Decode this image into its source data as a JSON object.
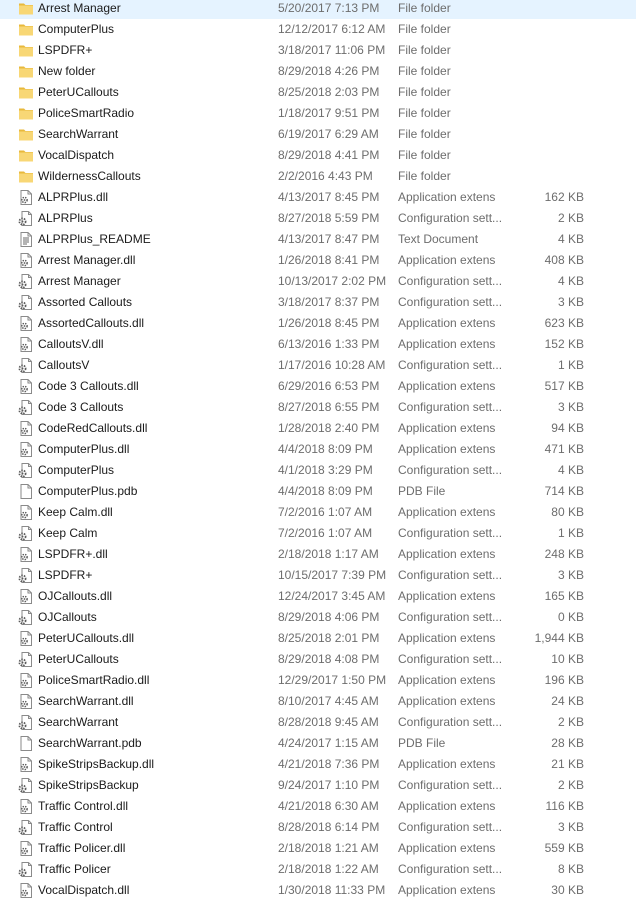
{
  "colors": {
    "folder": "#f8d775",
    "folder_shade": "#e8b93c",
    "text_primary": "#1a1a1a",
    "text_secondary": "#6d6d6d"
  },
  "files": [
    {
      "name": "Arrest Manager",
      "date": "5/20/2017 7:13 PM",
      "type": "File folder",
      "size": "",
      "icon": "folder-icon"
    },
    {
      "name": "ComputerPlus",
      "date": "12/12/2017 6:12 AM",
      "type": "File folder",
      "size": "",
      "icon": "folder-icon"
    },
    {
      "name": "LSPDFR+",
      "date": "3/18/2017 11:06 PM",
      "type": "File folder",
      "size": "",
      "icon": "folder-icon"
    },
    {
      "name": "New folder",
      "date": "8/29/2018 4:26 PM",
      "type": "File folder",
      "size": "",
      "icon": "folder-icon"
    },
    {
      "name": "PeterUCallouts",
      "date": "8/25/2018 2:03 PM",
      "type": "File folder",
      "size": "",
      "icon": "folder-icon"
    },
    {
      "name": "PoliceSmartRadio",
      "date": "1/18/2017 9:51 PM",
      "type": "File folder",
      "size": "",
      "icon": "folder-icon"
    },
    {
      "name": "SearchWarrant",
      "date": "6/19/2017 6:29 AM",
      "type": "File folder",
      "size": "",
      "icon": "folder-icon"
    },
    {
      "name": "VocalDispatch",
      "date": "8/29/2018 4:41 PM",
      "type": "File folder",
      "size": "",
      "icon": "folder-icon"
    },
    {
      "name": "WildernessCallouts",
      "date": "2/2/2016 4:43 PM",
      "type": "File folder",
      "size": "",
      "icon": "folder-icon"
    },
    {
      "name": "ALPRPlus.dll",
      "date": "4/13/2017 8:45 PM",
      "type": "Application extens",
      "size": "162 KB",
      "icon": "dll-file-icon"
    },
    {
      "name": "ALPRPlus",
      "date": "8/27/2018 5:59 PM",
      "type": "Configuration sett...",
      "size": "2 KB",
      "icon": "config-file-icon"
    },
    {
      "name": "ALPRPlus_README",
      "date": "4/13/2017 8:47 PM",
      "type": "Text Document",
      "size": "4 KB",
      "icon": "text-document-icon"
    },
    {
      "name": "Arrest Manager.dll",
      "date": "1/26/2018 8:41 PM",
      "type": "Application extens",
      "size": "408 KB",
      "icon": "dll-file-icon"
    },
    {
      "name": "Arrest Manager",
      "date": "10/13/2017 2:02 PM",
      "type": "Configuration sett...",
      "size": "4 KB",
      "icon": "config-file-icon"
    },
    {
      "name": "Assorted Callouts",
      "date": "3/18/2017 8:37 PM",
      "type": "Configuration sett...",
      "size": "3 KB",
      "icon": "config-file-icon"
    },
    {
      "name": "AssortedCallouts.dll",
      "date": "1/26/2018 8:45 PM",
      "type": "Application extens",
      "size": "623 KB",
      "icon": "dll-file-icon"
    },
    {
      "name": "CalloutsV.dll",
      "date": "6/13/2016 1:33 PM",
      "type": "Application extens",
      "size": "152 KB",
      "icon": "dll-file-icon"
    },
    {
      "name": "CalloutsV",
      "date": "1/17/2016 10:28 AM",
      "type": "Configuration sett...",
      "size": "1 KB",
      "icon": "config-file-icon"
    },
    {
      "name": "Code 3 Callouts.dll",
      "date": "6/29/2016 6:53 PM",
      "type": "Application extens",
      "size": "517 KB",
      "icon": "dll-file-icon"
    },
    {
      "name": "Code 3 Callouts",
      "date": "8/27/2018 6:55 PM",
      "type": "Configuration sett...",
      "size": "3 KB",
      "icon": "config-file-icon"
    },
    {
      "name": "CodeRedCallouts.dll",
      "date": "1/28/2018 2:40 PM",
      "type": "Application extens",
      "size": "94 KB",
      "icon": "dll-file-icon"
    },
    {
      "name": "ComputerPlus.dll",
      "date": "4/4/2018 8:09 PM",
      "type": "Application extens",
      "size": "471 KB",
      "icon": "dll-file-icon"
    },
    {
      "name": "ComputerPlus",
      "date": "4/1/2018 3:29 PM",
      "type": "Configuration sett...",
      "size": "4 KB",
      "icon": "config-file-icon"
    },
    {
      "name": "ComputerPlus.pdb",
      "date": "4/4/2018 8:09 PM",
      "type": "PDB File",
      "size": "714 KB",
      "icon": "blank-file-icon"
    },
    {
      "name": "Keep Calm.dll",
      "date": "7/2/2016 1:07 AM",
      "type": "Application extens",
      "size": "80 KB",
      "icon": "dll-file-icon"
    },
    {
      "name": "Keep Calm",
      "date": "7/2/2016 1:07 AM",
      "type": "Configuration sett...",
      "size": "1 KB",
      "icon": "config-file-icon"
    },
    {
      "name": "LSPDFR+.dll",
      "date": "2/18/2018 1:17 AM",
      "type": "Application extens",
      "size": "248 KB",
      "icon": "dll-file-icon"
    },
    {
      "name": "LSPDFR+",
      "date": "10/15/2017 7:39 PM",
      "type": "Configuration sett...",
      "size": "3 KB",
      "icon": "config-file-icon"
    },
    {
      "name": "OJCallouts.dll",
      "date": "12/24/2017 3:45 AM",
      "type": "Application extens",
      "size": "165 KB",
      "icon": "dll-file-icon"
    },
    {
      "name": "OJCallouts",
      "date": "8/29/2018 4:06 PM",
      "type": "Configuration sett...",
      "size": "0 KB",
      "icon": "config-file-icon"
    },
    {
      "name": "PeterUCallouts.dll",
      "date": "8/25/2018 2:01 PM",
      "type": "Application extens",
      "size": "1,944 KB",
      "icon": "dll-file-icon"
    },
    {
      "name": "PeterUCallouts",
      "date": "8/29/2018 4:08 PM",
      "type": "Configuration sett...",
      "size": "10 KB",
      "icon": "config-file-icon"
    },
    {
      "name": "PoliceSmartRadio.dll",
      "date": "12/29/2017 1:50 PM",
      "type": "Application extens",
      "size": "196 KB",
      "icon": "dll-file-icon"
    },
    {
      "name": "SearchWarrant.dll",
      "date": "8/10/2017 4:45 AM",
      "type": "Application extens",
      "size": "24 KB",
      "icon": "dll-file-icon"
    },
    {
      "name": "SearchWarrant",
      "date": "8/28/2018 9:45 AM",
      "type": "Configuration sett...",
      "size": "2 KB",
      "icon": "config-file-icon"
    },
    {
      "name": "SearchWarrant.pdb",
      "date": "4/24/2017 1:15 AM",
      "type": "PDB File",
      "size": "28 KB",
      "icon": "blank-file-icon"
    },
    {
      "name": "SpikeStripsBackup.dll",
      "date": "4/21/2018 7:36 PM",
      "type": "Application extens",
      "size": "21 KB",
      "icon": "dll-file-icon"
    },
    {
      "name": "SpikeStripsBackup",
      "date": "9/24/2017 1:10 PM",
      "type": "Configuration sett...",
      "size": "2 KB",
      "icon": "config-file-icon"
    },
    {
      "name": "Traffic Control.dll",
      "date": "4/21/2018 6:30 AM",
      "type": "Application extens",
      "size": "116 KB",
      "icon": "dll-file-icon"
    },
    {
      "name": "Traffic Control",
      "date": "8/28/2018 6:14 PM",
      "type": "Configuration sett...",
      "size": "3 KB",
      "icon": "config-file-icon"
    },
    {
      "name": "Traffic Policer.dll",
      "date": "2/18/2018 1:21 AM",
      "type": "Application extens",
      "size": "559 KB",
      "icon": "dll-file-icon"
    },
    {
      "name": "Traffic Policer",
      "date": "2/18/2018 1:22 AM",
      "type": "Configuration sett...",
      "size": "8 KB",
      "icon": "config-file-icon"
    },
    {
      "name": "VocalDispatch.dll",
      "date": "1/30/2018 11:33 PM",
      "type": "Application extens",
      "size": "30 KB",
      "icon": "dll-file-icon"
    }
  ]
}
